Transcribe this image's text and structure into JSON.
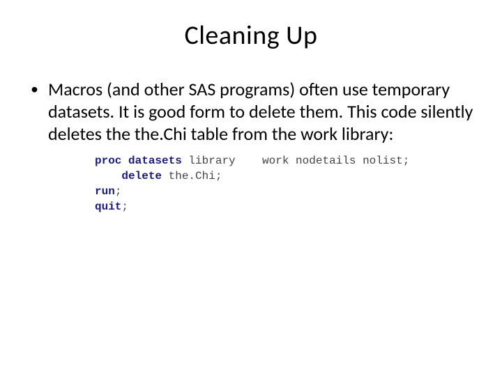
{
  "title": "Cleaning Up",
  "bullet": {
    "text": "Macros (and other SAS programs) often use temporary datasets.  It is good form to delete them.  This code silently deletes the the.Chi table from the work library:"
  },
  "code": {
    "kw_proc": "proc datasets",
    "tok_library": " library",
    "eq_gap": "    ",
    "tok_work": "work",
    "tok_opts": " nodetails nolist",
    "semi": ";",
    "indent": "    ",
    "kw_delete": "delete",
    "tok_dataset": " the.Chi",
    "kw_run": "run",
    "kw_quit": "quit"
  }
}
